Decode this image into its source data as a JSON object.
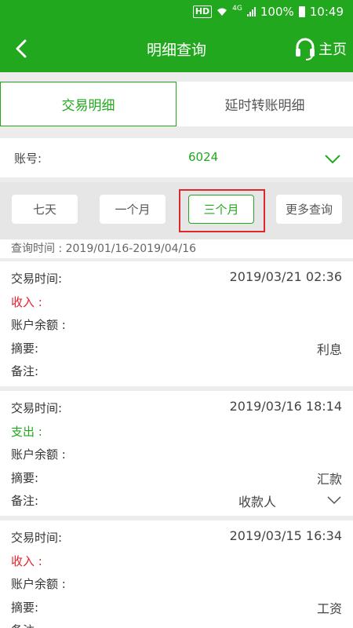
{
  "status_bar": {
    "hd": "HD",
    "network": "4G",
    "battery": "100%",
    "time": "10:49"
  },
  "app_bar": {
    "title": "明细查询",
    "home_label": "主页"
  },
  "tabs": [
    {
      "label": "交易明细",
      "active": true
    },
    {
      "label": "延时转账明细",
      "active": false
    }
  ],
  "account": {
    "label": "账号:",
    "number": "6024"
  },
  "filters": [
    {
      "label": "七天"
    },
    {
      "label": "一个月"
    },
    {
      "label": "三个月",
      "selected": true
    },
    {
      "label": "更多查询"
    }
  ],
  "query_time": "查询时间 : 2019/01/16-2019/04/16",
  "records": [
    {
      "time_label": "交易时间:",
      "time": "2019/03/21 02:36",
      "type": "收入 :",
      "kind": "income",
      "balance_label": "账户余额 :",
      "summary_label": "摘要:",
      "summary": "利息",
      "remark_label": "备注:",
      "remark": ""
    },
    {
      "time_label": "交易时间:",
      "time": "2019/03/16 18:14",
      "type": "支出 :",
      "kind": "expense",
      "balance_label": "账户余额 :",
      "summary_label": "摘要:",
      "summary": "汇款",
      "remark_label": "备注:",
      "remark": "收款人"
    },
    {
      "time_label": "交易时间:",
      "time": "2019/03/15 16:34",
      "type": "收入 :",
      "kind": "income",
      "balance_label": "账户余额 :",
      "summary_label": "摘要:",
      "summary": "工资",
      "remark_label": "备注:",
      "remark": ""
    }
  ],
  "icons": {
    "back": "back-arrow-icon",
    "home": "headset-icon",
    "account_dropdown": "chevron-down-icon",
    "record_expand": "chevron-down-icon"
  },
  "colors": {
    "brand": "#22a81f",
    "income": "#e8202a",
    "highlight": "#e0262d"
  }
}
